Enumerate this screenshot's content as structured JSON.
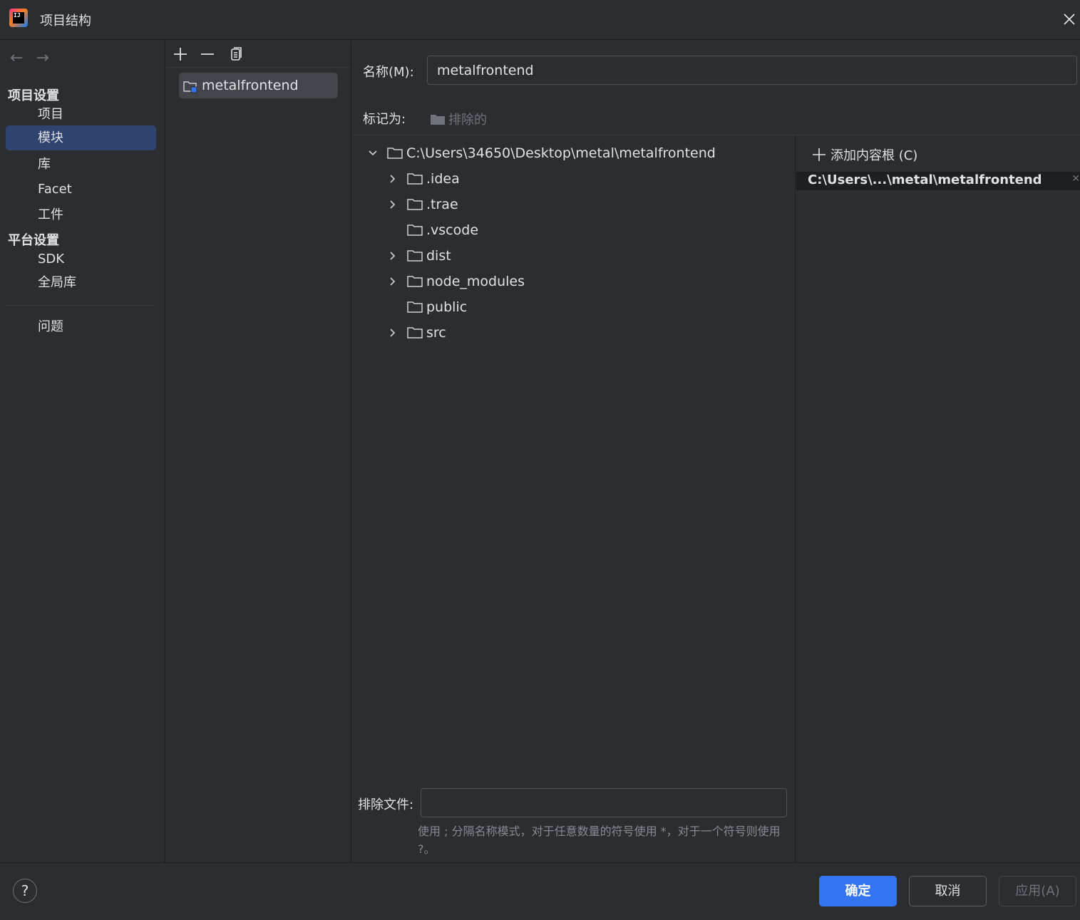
{
  "window": {
    "title": "项目结构"
  },
  "nav": {
    "project_settings_header": "项目设置",
    "project_items": [
      {
        "label": "项目"
      },
      {
        "label": "模块",
        "selected": true
      },
      {
        "label": "库"
      },
      {
        "label": "Facet"
      },
      {
        "label": "工件"
      }
    ],
    "platform_settings_header": "平台设置",
    "platform_items": [
      {
        "label": "SDK"
      },
      {
        "label": "全局库"
      }
    ],
    "problems_label": "问题"
  },
  "modules": {
    "items": [
      {
        "label": "metalfrontend"
      }
    ]
  },
  "details": {
    "name_label": "名称(M):",
    "name_value": "metalfrontend",
    "mark_as_label": "标记为:",
    "excluded_label": "排除的",
    "tree": {
      "root": "C:\\Users\\34650\\Desktop\\metal\\metalfrontend",
      "children": [
        {
          "label": ".idea",
          "expandable": true
        },
        {
          "label": ".trae",
          "expandable": true
        },
        {
          "label": ".vscode",
          "expandable": false
        },
        {
          "label": "dist",
          "expandable": true
        },
        {
          "label": "node_modules",
          "expandable": true
        },
        {
          "label": "public",
          "expandable": false
        },
        {
          "label": "src",
          "expandable": true
        }
      ]
    },
    "add_content_root_label": "添加内容根 (C)",
    "content_root_entry": "C:\\Users\\...\\metal\\metalfrontend",
    "exclude_files_label": "排除文件:",
    "exclude_files_value": "",
    "exclude_hint": "使用 ; 分隔名称模式，对于任意数量的符号使用 *，对于一个符号则使用 ?。"
  },
  "footer": {
    "help_label": "?",
    "ok_label": "确定",
    "cancel_label": "取消",
    "apply_label": "应用(A)"
  },
  "colors": {
    "background": "#2b2d30",
    "selection": "#2e436e",
    "primary_button": "#3574f0",
    "text": "#dfe1e5",
    "muted_text": "#6f737a"
  }
}
